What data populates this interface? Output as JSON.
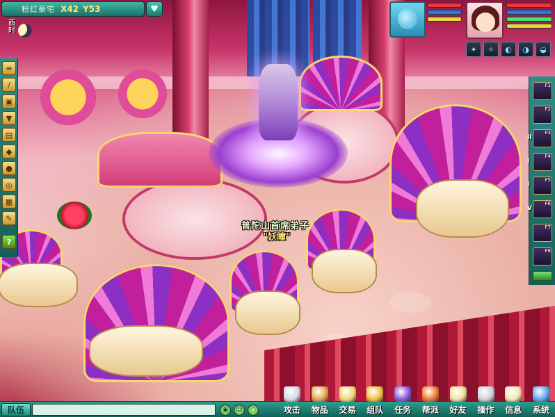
{
  "location": {
    "name": "粉红豪宅",
    "x_label": "X42",
    "y_label": "Y53",
    "map_button_icon": "heart-icon"
  },
  "time": {
    "label": "酉时",
    "icon": "moon-icon"
  },
  "left_toolbar": {
    "buttons": [
      {
        "name": "scroll-icon"
      },
      {
        "name": "sword-icon"
      },
      {
        "name": "bag-icon"
      },
      {
        "name": "trophy-icon"
      },
      {
        "name": "book-icon"
      },
      {
        "name": "gem-icon"
      },
      {
        "name": "coin-icon"
      },
      {
        "name": "question-icon"
      },
      {
        "name": "map-icon"
      },
      {
        "name": "settings-icon"
      },
      {
        "name": "help-icon",
        "label": "?"
      }
    ]
  },
  "status": {
    "pet_bars": [
      {
        "name": "pet-hp",
        "color": "#e8383a",
        "fill": 1.0
      },
      {
        "name": "pet-mp",
        "color": "#3a6fe8",
        "fill": 1.0
      },
      {
        "name": "pet-exp",
        "color": "#e8d83a",
        "fill": 1.0
      }
    ],
    "player_bars": [
      {
        "name": "player-hp",
        "color": "#e8383a",
        "fill": 1.0
      },
      {
        "name": "player-mp",
        "color": "#3a6fe8",
        "fill": 1.0
      },
      {
        "name": "player-anger",
        "color": "#3ae86a",
        "fill": 1.0
      },
      {
        "name": "player-exp",
        "color": "#e8d83a",
        "fill": 1.0
      }
    ]
  },
  "skills": [
    {
      "name": "skill-slot-1"
    },
    {
      "name": "skill-slot-2"
    },
    {
      "name": "skill-slot-3"
    },
    {
      "name": "skill-slot-4"
    }
  ],
  "hotbar": [
    {
      "key": "F1",
      "roman": ""
    },
    {
      "key": "F2",
      "roman": ""
    },
    {
      "key": "F3",
      "roman": "II"
    },
    {
      "key": "F4",
      "roman": "I"
    },
    {
      "key": "F5",
      "roman": "I"
    },
    {
      "key": "F6",
      "roman": "V"
    },
    {
      "key": "F7",
      "roman": ""
    },
    {
      "key": "F8",
      "roman": ""
    }
  ],
  "npc": {
    "title": "普陀山首席弟子",
    "name": "\"妖瞳\""
  },
  "chat": {
    "team_label": "队伍"
  },
  "menu": [
    {
      "label": "攻击",
      "icon": "sword-icon",
      "color": "#d8d8e8"
    },
    {
      "label": "物品",
      "icon": "chest-icon",
      "color": "#e8a84a"
    },
    {
      "label": "交易",
      "icon": "trade-icon",
      "color": "#f2d870"
    },
    {
      "label": "组队",
      "icon": "team-icon",
      "color": "#f0c040"
    },
    {
      "label": "任务",
      "icon": "quest-icon",
      "color": "#8a5ad8"
    },
    {
      "label": "帮派",
      "icon": "guild-icon",
      "color": "#f07830"
    },
    {
      "label": "好友",
      "icon": "friend-icon",
      "color": "#f0e0a0"
    },
    {
      "label": "操作",
      "icon": "gear-icon",
      "color": "#d0d0d8"
    },
    {
      "label": "信息",
      "icon": "letter-icon",
      "color": "#f2e6b0"
    },
    {
      "label": "系统",
      "icon": "system-icon",
      "color": "#60a8f0"
    }
  ]
}
